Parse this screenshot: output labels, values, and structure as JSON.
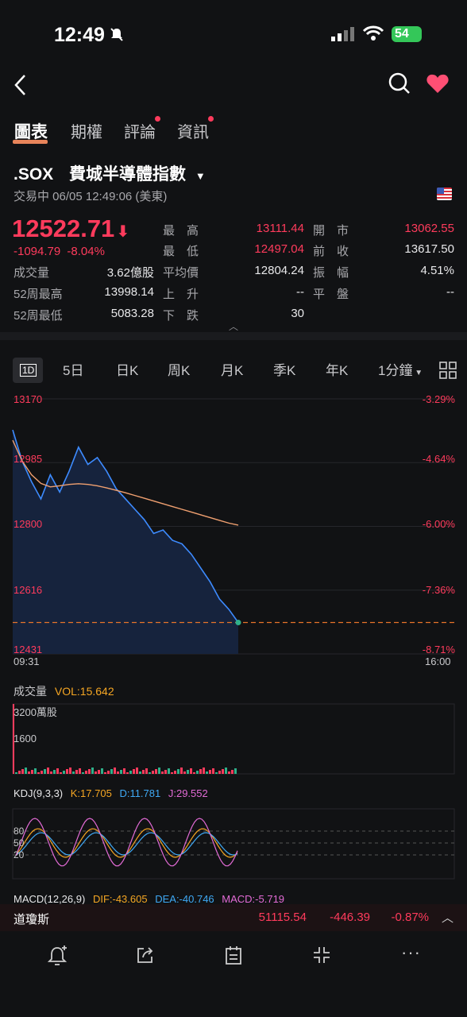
{
  "status": {
    "time": "12:49",
    "battery": "54"
  },
  "tabs": [
    {
      "label": "圖表"
    },
    {
      "label": "期權"
    },
    {
      "label": "評論"
    },
    {
      "label": "資訊"
    }
  ],
  "quote": {
    "symbol": ".SOX",
    "name": "費城半導體指數",
    "status_line": "交易中 06/05 12:49:06 (美東)",
    "price": "12522.71",
    "change": "-1094.79",
    "change_pct": "-8.04%",
    "stats": {
      "high_label": "最　高",
      "high": "13111.44",
      "low_label": "最　低",
      "low": "12497.04",
      "avg_label": "平均價",
      "avg": "12804.24",
      "up_label": "上　升",
      "up": "--",
      "down_label": "下　跌",
      "down": "30",
      "open_label": "開　市",
      "open": "13062.55",
      "prev_label": "前　收",
      "prev": "13617.50",
      "amp_label": "振　幅",
      "amp": "4.51%",
      "flat_label": "平　盤",
      "flat": "--",
      "vol_label": "成交量",
      "vol": "3.62億股",
      "hi52_label": "52周最高",
      "hi52": "13998.14",
      "lo52_label": "52周最低",
      "lo52": "5083.28"
    }
  },
  "periods": [
    "1D",
    "5日",
    "日K",
    "周K",
    "月K",
    "季K",
    "年K",
    "1分鐘"
  ],
  "chart_data": {
    "type": "line",
    "y_ticks": [
      "13170",
      "12985",
      "12800",
      "12616",
      "12431"
    ],
    "pct_ticks": [
      "-3.29%",
      "-4.64%",
      "-6.00%",
      "-7.36%",
      "-8.71%"
    ],
    "x_start": "09:31",
    "x_end": "16:00",
    "ylim": [
      12431,
      13170
    ],
    "price_series": [
      13080,
      12990,
      12930,
      12880,
      12950,
      12900,
      12960,
      13030,
      12980,
      13000,
      12960,
      12910,
      12880,
      12850,
      12820,
      12780,
      12790,
      12760,
      12750,
      12720,
      12680,
      12640,
      12590,
      12560,
      12522
    ],
    "avg_series": [
      13050,
      12990,
      12950,
      12925,
      12915,
      12918,
      12922,
      12924,
      12922,
      12918,
      12912,
      12905,
      12898,
      12890,
      12882,
      12874,
      12866,
      12858,
      12850,
      12842,
      12834,
      12826,
      12818,
      12810,
      12804
    ]
  },
  "volume": {
    "title": "成交量",
    "value": "VOL:15.642",
    "tick_top": "3200萬股",
    "tick_mid": "1600"
  },
  "kdj": {
    "title": "KDJ(9,3,3)",
    "k": "K:17.705",
    "d": "D:11.781",
    "j": "J:29.552",
    "ticks": [
      "80",
      "50",
      "20"
    ]
  },
  "macd": {
    "title": "MACD(12,26,9)",
    "dif": "DIF:-43.605",
    "dea": "DEA:-40.746",
    "macd": "MACD:-5.719"
  },
  "index_bar": {
    "name": "道瓊斯",
    "price": "51115.54",
    "change": "-446.39",
    "pct": "-0.87%"
  },
  "colors": {
    "down": "#ff3b5c",
    "line": "#3d8bff",
    "avg": "#f0a070",
    "k": "#f5a623",
    "d": "#3fa9f5",
    "j": "#e36bd6"
  }
}
